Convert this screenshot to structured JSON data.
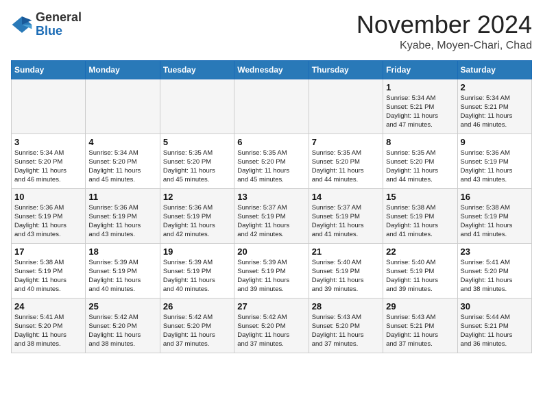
{
  "header": {
    "logo_line1": "General",
    "logo_line2": "Blue",
    "month": "November 2024",
    "location": "Kyabe, Moyen-Chari, Chad"
  },
  "days_of_week": [
    "Sunday",
    "Monday",
    "Tuesday",
    "Wednesday",
    "Thursday",
    "Friday",
    "Saturday"
  ],
  "weeks": [
    [
      {
        "day": "",
        "info": ""
      },
      {
        "day": "",
        "info": ""
      },
      {
        "day": "",
        "info": ""
      },
      {
        "day": "",
        "info": ""
      },
      {
        "day": "",
        "info": ""
      },
      {
        "day": "1",
        "info": "Sunrise: 5:34 AM\nSunset: 5:21 PM\nDaylight: 11 hours\nand 47 minutes."
      },
      {
        "day": "2",
        "info": "Sunrise: 5:34 AM\nSunset: 5:21 PM\nDaylight: 11 hours\nand 46 minutes."
      }
    ],
    [
      {
        "day": "3",
        "info": "Sunrise: 5:34 AM\nSunset: 5:20 PM\nDaylight: 11 hours\nand 46 minutes."
      },
      {
        "day": "4",
        "info": "Sunrise: 5:34 AM\nSunset: 5:20 PM\nDaylight: 11 hours\nand 45 minutes."
      },
      {
        "day": "5",
        "info": "Sunrise: 5:35 AM\nSunset: 5:20 PM\nDaylight: 11 hours\nand 45 minutes."
      },
      {
        "day": "6",
        "info": "Sunrise: 5:35 AM\nSunset: 5:20 PM\nDaylight: 11 hours\nand 45 minutes."
      },
      {
        "day": "7",
        "info": "Sunrise: 5:35 AM\nSunset: 5:20 PM\nDaylight: 11 hours\nand 44 minutes."
      },
      {
        "day": "8",
        "info": "Sunrise: 5:35 AM\nSunset: 5:20 PM\nDaylight: 11 hours\nand 44 minutes."
      },
      {
        "day": "9",
        "info": "Sunrise: 5:36 AM\nSunset: 5:19 PM\nDaylight: 11 hours\nand 43 minutes."
      }
    ],
    [
      {
        "day": "10",
        "info": "Sunrise: 5:36 AM\nSunset: 5:19 PM\nDaylight: 11 hours\nand 43 minutes."
      },
      {
        "day": "11",
        "info": "Sunrise: 5:36 AM\nSunset: 5:19 PM\nDaylight: 11 hours\nand 43 minutes."
      },
      {
        "day": "12",
        "info": "Sunrise: 5:36 AM\nSunset: 5:19 PM\nDaylight: 11 hours\nand 42 minutes."
      },
      {
        "day": "13",
        "info": "Sunrise: 5:37 AM\nSunset: 5:19 PM\nDaylight: 11 hours\nand 42 minutes."
      },
      {
        "day": "14",
        "info": "Sunrise: 5:37 AM\nSunset: 5:19 PM\nDaylight: 11 hours\nand 41 minutes."
      },
      {
        "day": "15",
        "info": "Sunrise: 5:38 AM\nSunset: 5:19 PM\nDaylight: 11 hours\nand 41 minutes."
      },
      {
        "day": "16",
        "info": "Sunrise: 5:38 AM\nSunset: 5:19 PM\nDaylight: 11 hours\nand 41 minutes."
      }
    ],
    [
      {
        "day": "17",
        "info": "Sunrise: 5:38 AM\nSunset: 5:19 PM\nDaylight: 11 hours\nand 40 minutes."
      },
      {
        "day": "18",
        "info": "Sunrise: 5:39 AM\nSunset: 5:19 PM\nDaylight: 11 hours\nand 40 minutes."
      },
      {
        "day": "19",
        "info": "Sunrise: 5:39 AM\nSunset: 5:19 PM\nDaylight: 11 hours\nand 40 minutes."
      },
      {
        "day": "20",
        "info": "Sunrise: 5:39 AM\nSunset: 5:19 PM\nDaylight: 11 hours\nand 39 minutes."
      },
      {
        "day": "21",
        "info": "Sunrise: 5:40 AM\nSunset: 5:19 PM\nDaylight: 11 hours\nand 39 minutes."
      },
      {
        "day": "22",
        "info": "Sunrise: 5:40 AM\nSunset: 5:19 PM\nDaylight: 11 hours\nand 39 minutes."
      },
      {
        "day": "23",
        "info": "Sunrise: 5:41 AM\nSunset: 5:20 PM\nDaylight: 11 hours\nand 38 minutes."
      }
    ],
    [
      {
        "day": "24",
        "info": "Sunrise: 5:41 AM\nSunset: 5:20 PM\nDaylight: 11 hours\nand 38 minutes."
      },
      {
        "day": "25",
        "info": "Sunrise: 5:42 AM\nSunset: 5:20 PM\nDaylight: 11 hours\nand 38 minutes."
      },
      {
        "day": "26",
        "info": "Sunrise: 5:42 AM\nSunset: 5:20 PM\nDaylight: 11 hours\nand 37 minutes."
      },
      {
        "day": "27",
        "info": "Sunrise: 5:42 AM\nSunset: 5:20 PM\nDaylight: 11 hours\nand 37 minutes."
      },
      {
        "day": "28",
        "info": "Sunrise: 5:43 AM\nSunset: 5:20 PM\nDaylight: 11 hours\nand 37 minutes."
      },
      {
        "day": "29",
        "info": "Sunrise: 5:43 AM\nSunset: 5:21 PM\nDaylight: 11 hours\nand 37 minutes."
      },
      {
        "day": "30",
        "info": "Sunrise: 5:44 AM\nSunset: 5:21 PM\nDaylight: 11 hours\nand 36 minutes."
      }
    ]
  ]
}
